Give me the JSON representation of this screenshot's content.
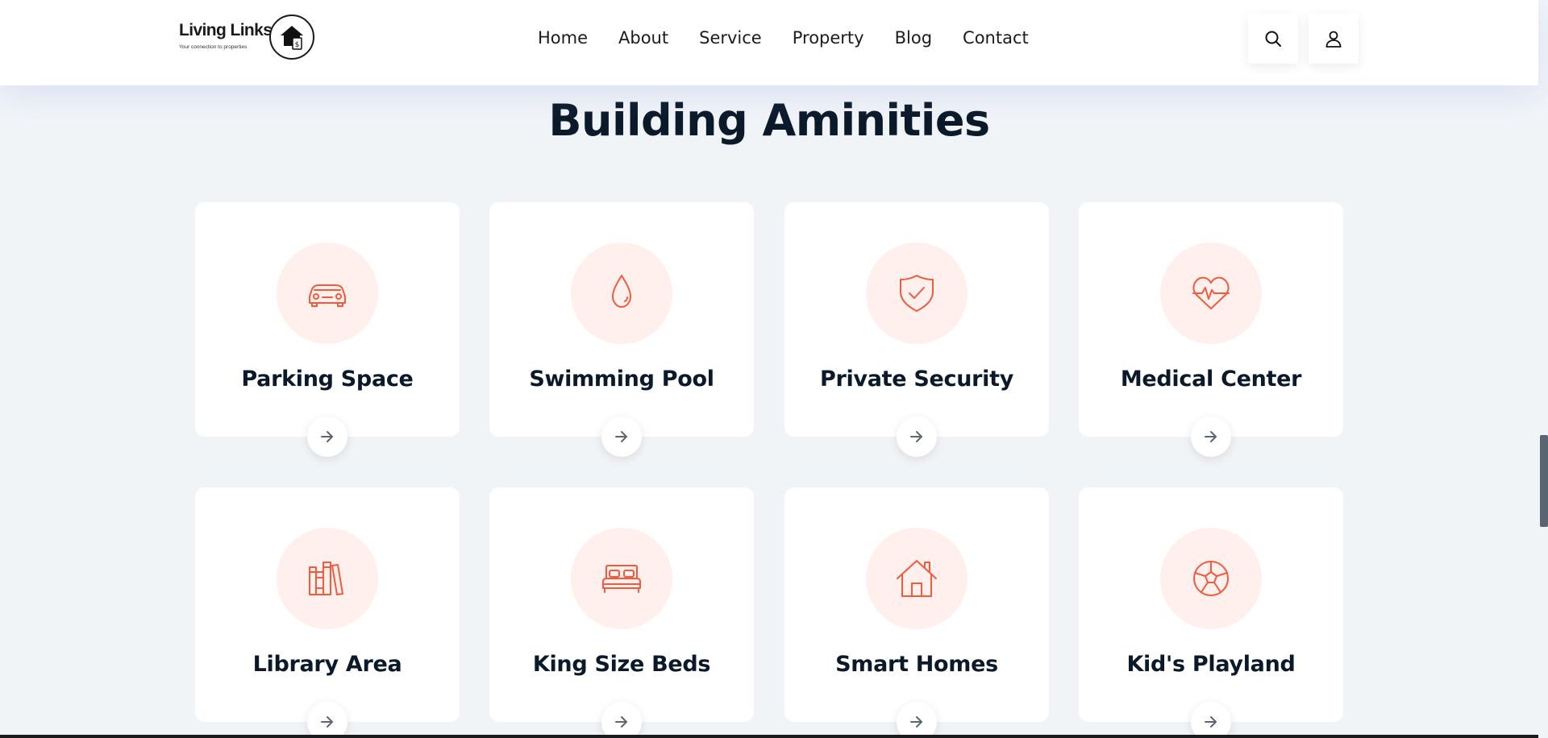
{
  "brand": {
    "name": "Living Links",
    "tagline": "Your connection to properties",
    "logo_icon": "house-dollar-icon"
  },
  "nav": {
    "items": [
      "Home",
      "About",
      "Service",
      "Property",
      "Blog",
      "Contact"
    ]
  },
  "header_actions": {
    "search_icon": "search-icon",
    "user_icon": "user-icon"
  },
  "section": {
    "title": "Building Aminities"
  },
  "amenities": [
    {
      "label": "Parking Space",
      "icon": "car-icon"
    },
    {
      "label": "Swimming Pool",
      "icon": "water-drop-icon"
    },
    {
      "label": "Private Security",
      "icon": "shield-check-icon"
    },
    {
      "label": "Medical Center",
      "icon": "heart-pulse-icon"
    },
    {
      "label": "Library Area",
      "icon": "books-icon"
    },
    {
      "label": "King Size Beds",
      "icon": "bed-icon"
    },
    {
      "label": "Smart Homes",
      "icon": "house-icon"
    },
    {
      "label": "Kid's Playland",
      "icon": "soccer-ball-icon"
    }
  ],
  "card_action_icon": "arrow-right-icon",
  "colors": {
    "accent": "#f35a3c",
    "icon_bg": "#fff0ee",
    "page_bg": "#f1f4f7",
    "heading": "#0b1a2a"
  }
}
